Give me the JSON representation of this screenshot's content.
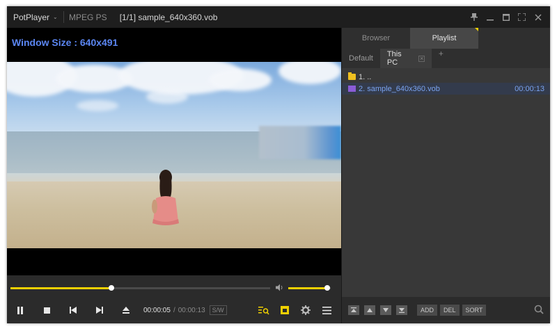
{
  "titlebar": {
    "app_name": "PotPlayer",
    "format": "MPEG PS",
    "file_title": "[1/1] sample_640x360.vob",
    "icons": [
      "pin-icon",
      "minimize-icon",
      "maximize-icon",
      "fullscreen-icon",
      "close-icon"
    ]
  },
  "video": {
    "osd_text": "Window Size : 640x491"
  },
  "seek": {
    "progress": 0.39,
    "volume": 0.92
  },
  "controls": {
    "current_time": "00:00:05",
    "separator": "/",
    "total_time": "00:00:13",
    "sw_label": "S/W"
  },
  "panel": {
    "tabs": [
      {
        "label": "Browser"
      },
      {
        "label": "Playlist"
      }
    ],
    "sub_tabs": [
      {
        "label": "Default"
      },
      {
        "label": "This PC"
      }
    ],
    "add_tab": "+",
    "rows": [
      {
        "label": "1. ..",
        "duration": ""
      },
      {
        "label": "2. sample_640x360.vob",
        "duration": "00:00:13"
      }
    ],
    "bottom": {
      "add": "ADD",
      "del": "DEL",
      "sort": "SORT"
    }
  },
  "colors": {
    "accent": "#f0d000",
    "osd": "#5b86f2",
    "playing": "#7aa3f0"
  }
}
